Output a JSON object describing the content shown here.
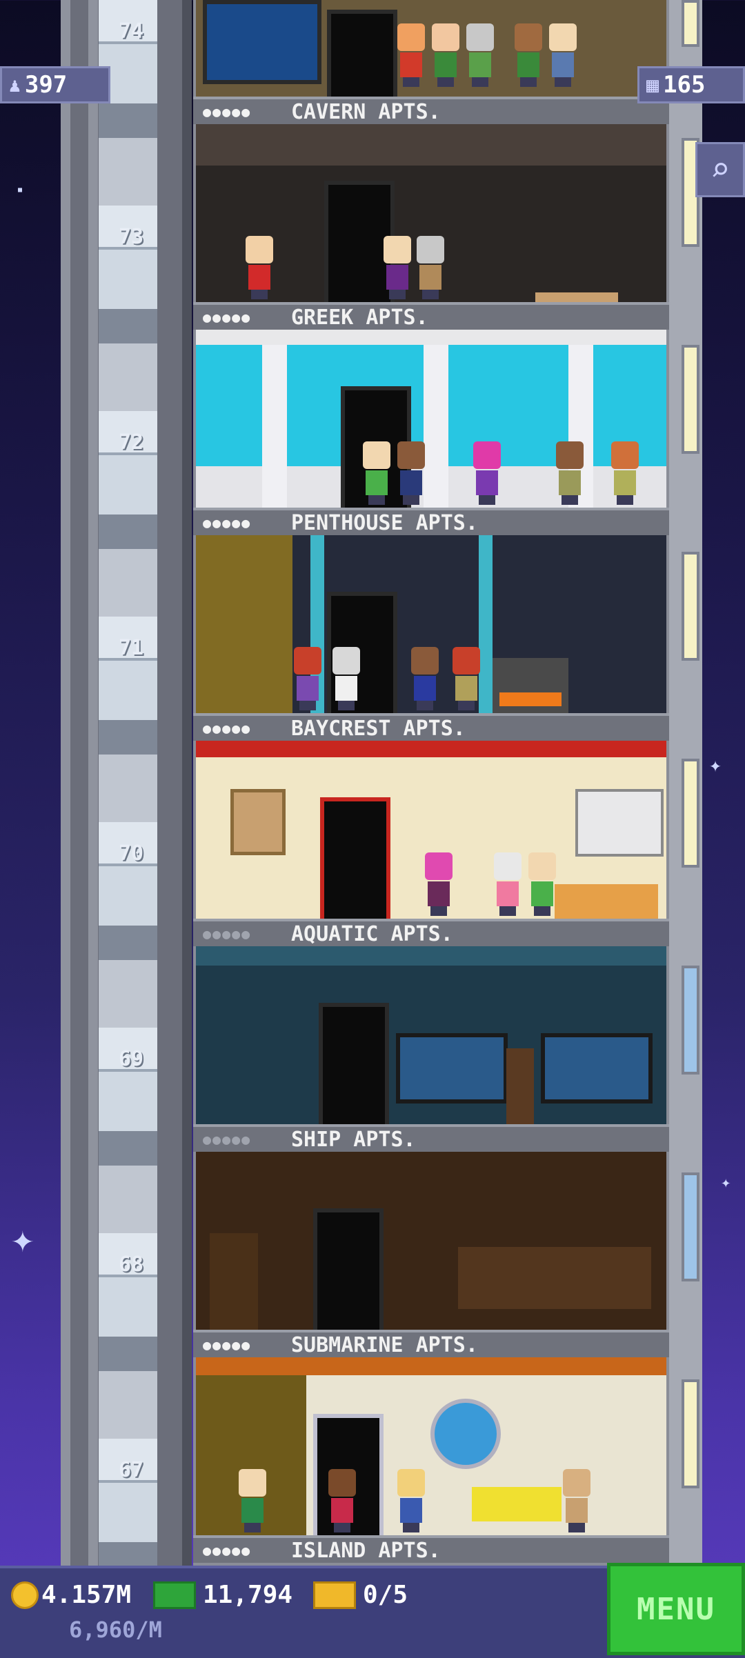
{
  "hud": {
    "population": "397",
    "floors": "165"
  },
  "floors": [
    {
      "number": "74",
      "label": "CAVERN APTS."
    },
    {
      "number": "73",
      "label": "GREEK APTS."
    },
    {
      "number": "72",
      "label": "PENTHOUSE APTS."
    },
    {
      "number": "71",
      "label": "BAYCREST APTS."
    },
    {
      "number": "70",
      "label": "AQUATIC APTS."
    },
    {
      "number": "69",
      "label": "SHIP APTS."
    },
    {
      "number": "68",
      "label": "SUBMARINE APTS."
    },
    {
      "number": "67",
      "label": "ISLAND APTS."
    }
  ],
  "rooms": [
    {
      "theme": "cavern",
      "bg": "#2a2624",
      "accent": "#e8dca0"
    },
    {
      "theme": "greek",
      "bg": "#28c6e2",
      "accent": "#f4f4f4"
    },
    {
      "theme": "penthouse",
      "bg": "#252a3a",
      "accent": "#3fb6c8"
    },
    {
      "theme": "baycrest",
      "bg": "#f1e7c6",
      "accent": "#c8261f"
    },
    {
      "theme": "aquatic",
      "bg": "#1e3a4a",
      "accent": "#2c5a6e"
    },
    {
      "theme": "ship",
      "bg": "#3a2616",
      "accent": "#5a3b20"
    },
    {
      "theme": "submarine",
      "bg": "#e9e4d2",
      "accent": "#6e5a1a"
    }
  ],
  "bottombar": {
    "coins": "4.157M",
    "coins_rate": "6,960/M",
    "bux": "11,794",
    "tickets": "0/5",
    "menu_label": "MENU"
  },
  "icons": {
    "population": "person-icon",
    "floors": "building-icon",
    "search": "magnifier-icon"
  },
  "colors": {
    "menu_green": "#33c23a",
    "coin_gold": "#f3c12d",
    "bux_green": "#2ea53a"
  }
}
